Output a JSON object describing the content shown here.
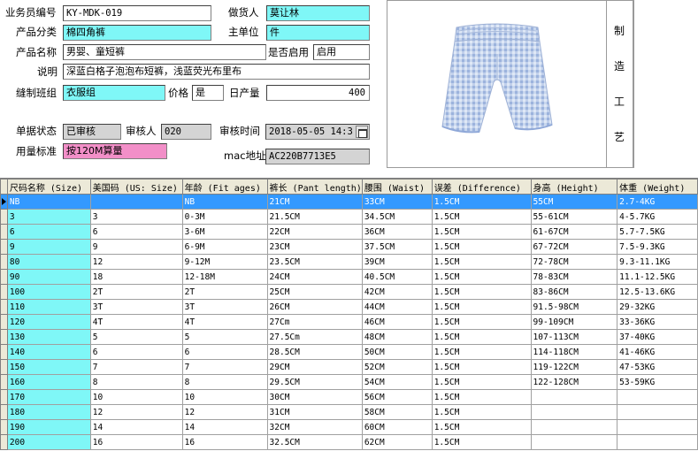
{
  "form": {
    "salesman_no": {
      "label": "业务员编号",
      "value": "KY-MDK-019"
    },
    "maker": {
      "label": "做货人",
      "value": "莫让林"
    },
    "category": {
      "label": "产品分类",
      "value": "棉四角裤"
    },
    "unit": {
      "label": "主单位",
      "value": "件"
    },
    "product_name": {
      "label": "产品名称",
      "value": "男婴、童短裤"
    },
    "enabled": {
      "label": "是否启用",
      "value": "启用"
    },
    "description": {
      "label": "说明",
      "value": "深蓝白格子泡泡布短裤，浅蓝荧光布里布"
    },
    "sewing_team": {
      "label": "缝制班组",
      "value": "衣服组"
    },
    "price": {
      "label": "价格",
      "value": "是"
    },
    "daily_output": {
      "label": "日产量",
      "value": "400"
    },
    "doc_status": {
      "label": "单据状态",
      "value": "已审核"
    },
    "reviewer": {
      "label": "审核人",
      "value": "020"
    },
    "review_time": {
      "label": "审核时间",
      "value": "2018-05-05  14:3"
    },
    "usage_std": {
      "label": "用量标准",
      "value": "按120M算量"
    },
    "mac": {
      "label": "mac地址",
      "value": "AC220B7713E5"
    }
  },
  "side_label": [
    "制",
    "造",
    "工",
    "艺"
  ],
  "photo": {
    "description_icon": "plaid-shorts-image",
    "colors": {
      "fabric": "#c7d6ee",
      "check": "#8fa8d8",
      "band": "#e8eef8"
    }
  },
  "colors": {
    "cyan": "#7ff7f7",
    "pink": "#f28fc8",
    "selection": "#3399ff"
  },
  "table": {
    "headers": [
      "尺码名称 (Size)",
      "美国码 (US: Size)",
      "年龄 (Fit ages)",
      "裤长 (Pant length)",
      "腰围 (Waist)",
      "误差 (Difference)",
      "身高 (Height)",
      "体重 (Weight)"
    ],
    "rows": [
      [
        "NB",
        "",
        "NB",
        "21CM",
        "33CM",
        "1.5CM",
        "55CM",
        "2.7-4KG"
      ],
      [
        "3",
        "3",
        "0-3M",
        "21.5CM",
        "34.5CM",
        "1.5CM",
        "55-61CM",
        "4-5.7KG"
      ],
      [
        "6",
        "6",
        "3-6M",
        "22CM",
        "36CM",
        "1.5CM",
        "61-67CM",
        "5.7-7.5KG"
      ],
      [
        "9",
        "9",
        "6-9M",
        "23CM",
        "37.5CM",
        "1.5CM",
        "67-72CM",
        "7.5-9.3KG"
      ],
      [
        "80",
        "12",
        "9-12M",
        "23.5CM",
        "39CM",
        "1.5CM",
        "72-78CM",
        "9.3-11.1KG"
      ],
      [
        "90",
        "18",
        "12-18M",
        "24CM",
        "40.5CM",
        "1.5CM",
        "78-83CM",
        "11.1-12.5KG"
      ],
      [
        "100",
        "2T",
        "2T",
        "25CM",
        "42CM",
        "1.5CM",
        "83-86CM",
        "12.5-13.6KG"
      ],
      [
        "110",
        "3T",
        "3T",
        "26CM",
        "44CM",
        "1.5CM",
        "91.5-98CM",
        "29-32KG"
      ],
      [
        "120",
        "4T",
        "4T",
        "27Cm",
        "46CM",
        "1.5CM",
        "99-109CM",
        "33-36KG"
      ],
      [
        "130",
        "5",
        "5",
        "27.5Cm",
        "48CM",
        "1.5CM",
        "107-113CM",
        "37-40KG"
      ],
      [
        "140",
        "6",
        "6",
        "28.5CM",
        "50CM",
        "1.5CM",
        "114-118CM",
        "41-46KG"
      ],
      [
        "150",
        "7",
        "7",
        "29CM",
        "52CM",
        "1.5CM",
        "119-122CM",
        "47-53KG"
      ],
      [
        "160",
        "8",
        "8",
        "29.5CM",
        "54CM",
        "1.5CM",
        "122-128CM",
        "53-59KG"
      ],
      [
        "170",
        "10",
        "10",
        "30CM",
        "56CM",
        "1.5CM",
        "",
        ""
      ],
      [
        "180",
        "12",
        "12",
        "31CM",
        "58CM",
        "1.5CM",
        "",
        ""
      ],
      [
        "190",
        "14",
        "14",
        "32CM",
        "60CM",
        "1.5CM",
        "",
        ""
      ],
      [
        "200",
        "16",
        "16",
        "32.5CM",
        "62CM",
        "1.5CM",
        "",
        ""
      ]
    ],
    "selected_row": 0
  }
}
